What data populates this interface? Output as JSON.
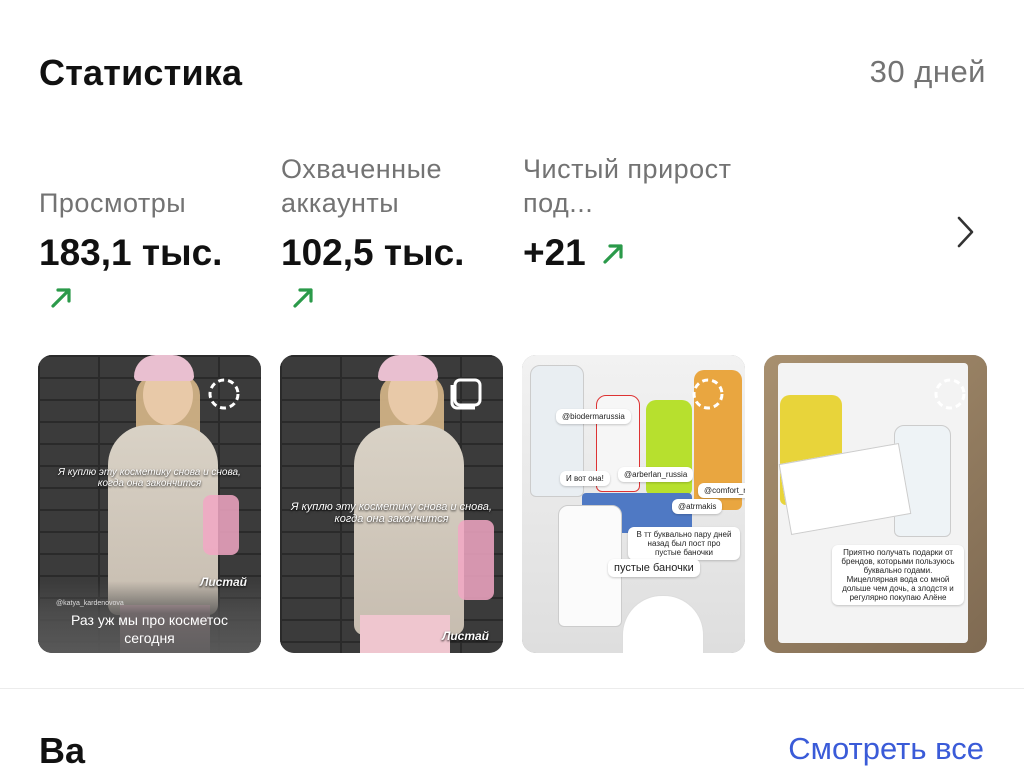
{
  "header": {
    "title": "Статистика",
    "period": "30 дней"
  },
  "metrics": [
    {
      "label": "Просмотры",
      "value": "183,1 тыс.",
      "trend": "up"
    },
    {
      "label": "Охваченные аккаунты",
      "value": "102,5 тыс.",
      "trend": "up"
    },
    {
      "label": "Чистый прирост под...",
      "value": "+21",
      "trend": "up"
    }
  ],
  "colors": {
    "trend_up": "#2b9a4a",
    "link": "#3a5bd8",
    "muted": "#737373"
  },
  "posts": [
    {
      "type_icon": "reel-loading-icon",
      "overlay": "Я куплю эту косметику снова и снова, когда она закончится",
      "listai": "Листай",
      "handle": "@katya_kardenovova",
      "caption": "Раз уж мы про косметос сегодня"
    },
    {
      "type_icon": "carousel-icon",
      "overlay": "Я куплю эту косметику снова и снова, когда она закончится",
      "listai": "Листай"
    },
    {
      "type_icon": "reel-loading-icon",
      "stickers": [
        "@biodermarussia",
        "И вот она!",
        "@arberlan_russia",
        "@comfort_russia",
        "@atrmakis",
        "В тт буквально пару дней назад был пост про пустые баночки",
        "пустые баночки"
      ]
    },
    {
      "type_icon": "reel-loading-icon",
      "note": "Приятно получать подарки от брендов, которыми пользуюсь буквально годами. Мицеллярная вода со мной дольше чем дочь, а злодстя и регулярно покупаю Алёне"
    }
  ],
  "next_section": {
    "title": "Ва",
    "see_all": "Смотреть все"
  }
}
